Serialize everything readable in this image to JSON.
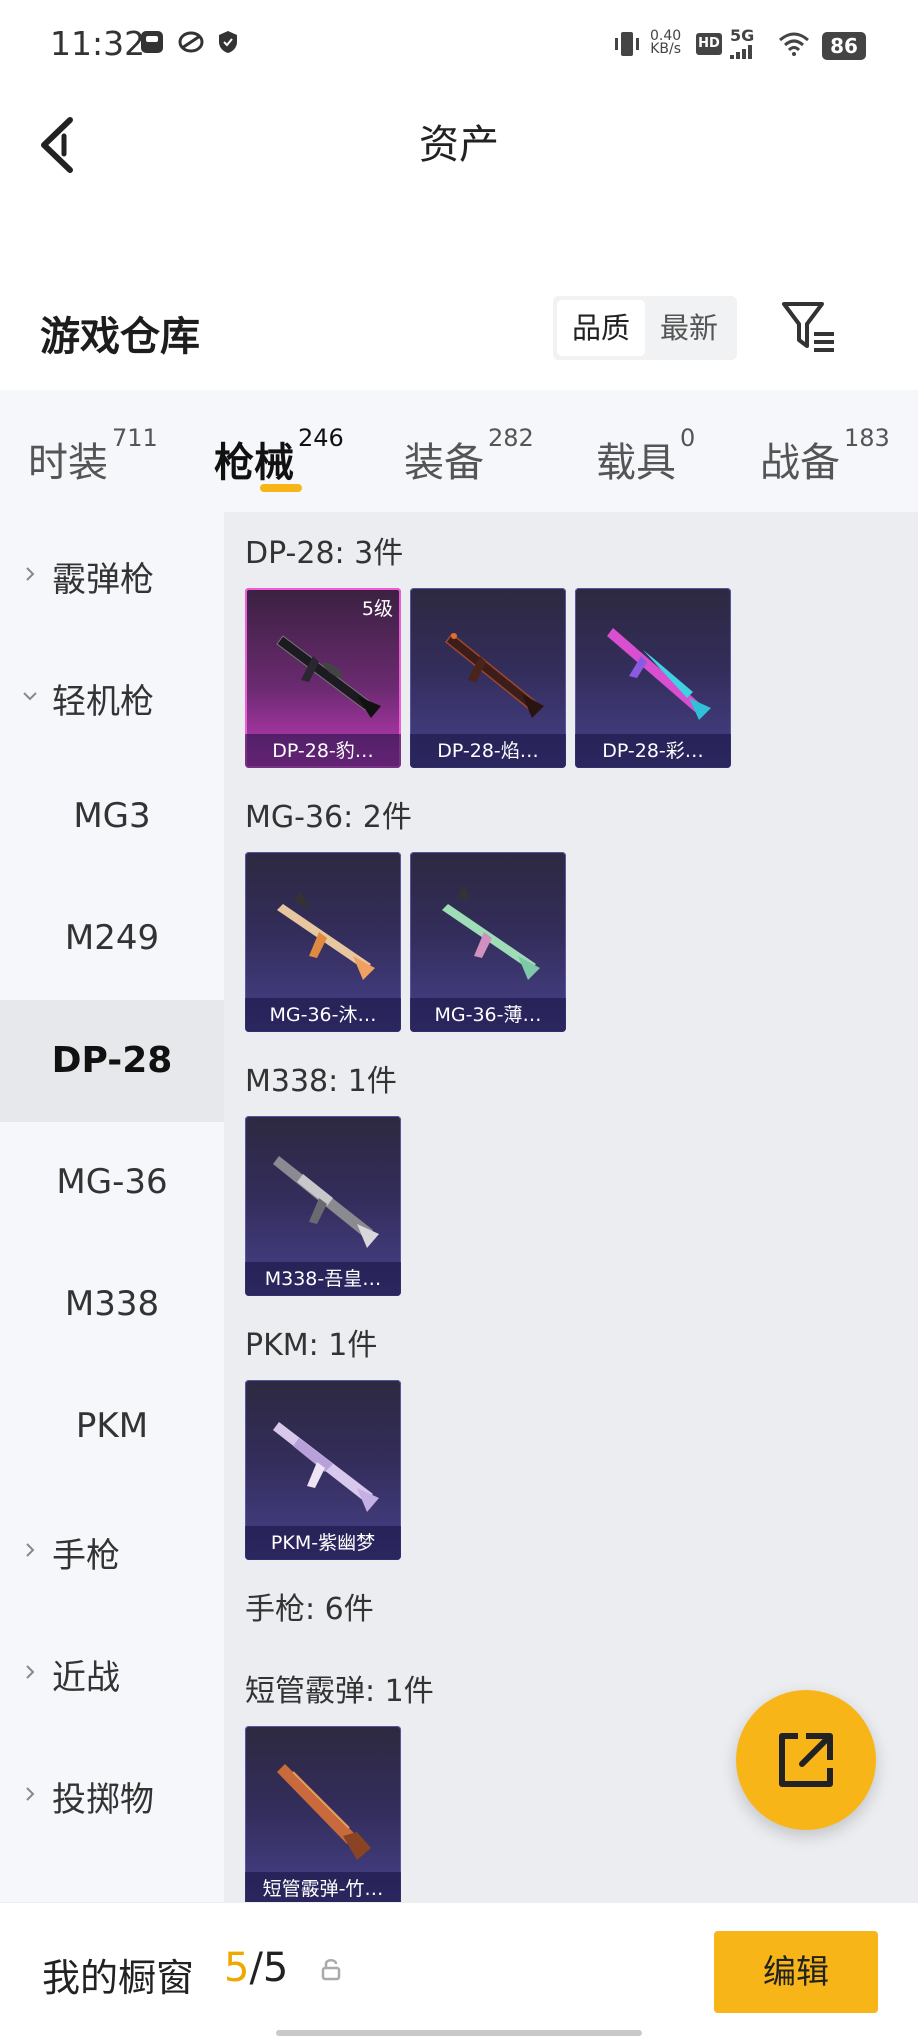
{
  "status_bar": {
    "time": "11:32",
    "network_speed": "0.40",
    "network_speed_unit": "KB/s",
    "hd": "HD",
    "signal": "5G",
    "battery": "86"
  },
  "header": {
    "title": "资产"
  },
  "warehouse": {
    "title": "游戏仓库",
    "sort_options": [
      "品质",
      "最新"
    ]
  },
  "tabs": [
    {
      "label": "时装",
      "count": "711"
    },
    {
      "label": "枪械",
      "count": "246"
    },
    {
      "label": "装备",
      "count": "282"
    },
    {
      "label": "载具",
      "count": "0"
    },
    {
      "label": "战备",
      "count": "183"
    }
  ],
  "side_nav": [
    {
      "label": "霰弹枪"
    },
    {
      "label": "轻机枪"
    },
    {
      "label": "MG3"
    },
    {
      "label": "M249"
    },
    {
      "label": "DP-28"
    },
    {
      "label": "MG-36"
    },
    {
      "label": "M338"
    },
    {
      "label": "PKM"
    },
    {
      "label": "手枪"
    },
    {
      "label": "近战"
    },
    {
      "label": "投掷物"
    }
  ],
  "sections": [
    {
      "title": "DP-28: 3件",
      "items": [
        {
          "name": "DP-28-豹…",
          "level": "5级"
        },
        {
          "name": "DP-28-焰…"
        },
        {
          "name": "DP-28-彩…"
        }
      ]
    },
    {
      "title": "MG-36: 2件",
      "items": [
        {
          "name": "MG-36-沐…"
        },
        {
          "name": "MG-36-薄…"
        }
      ]
    },
    {
      "title": "M338: 1件",
      "items": [
        {
          "name": "M338-吾皇…"
        }
      ]
    },
    {
      "title": "PKM: 1件",
      "items": [
        {
          "name": "PKM-紫幽梦"
        }
      ]
    },
    {
      "title": "手枪: 6件"
    },
    {
      "title": "短管霰弹: 1件",
      "items": [
        {
          "name": "短管霰弹-竹…"
        }
      ]
    }
  ],
  "bottom_bar": {
    "showcase_label": "我的橱窗",
    "showcase_current": "5",
    "showcase_total": "/5",
    "edit_label": "编辑"
  },
  "colors": {
    "accent": "#f8b518",
    "tab_indicator": "#f8b51a",
    "legendary_card": "#c63bbd",
    "epic_card": "#47418a"
  }
}
